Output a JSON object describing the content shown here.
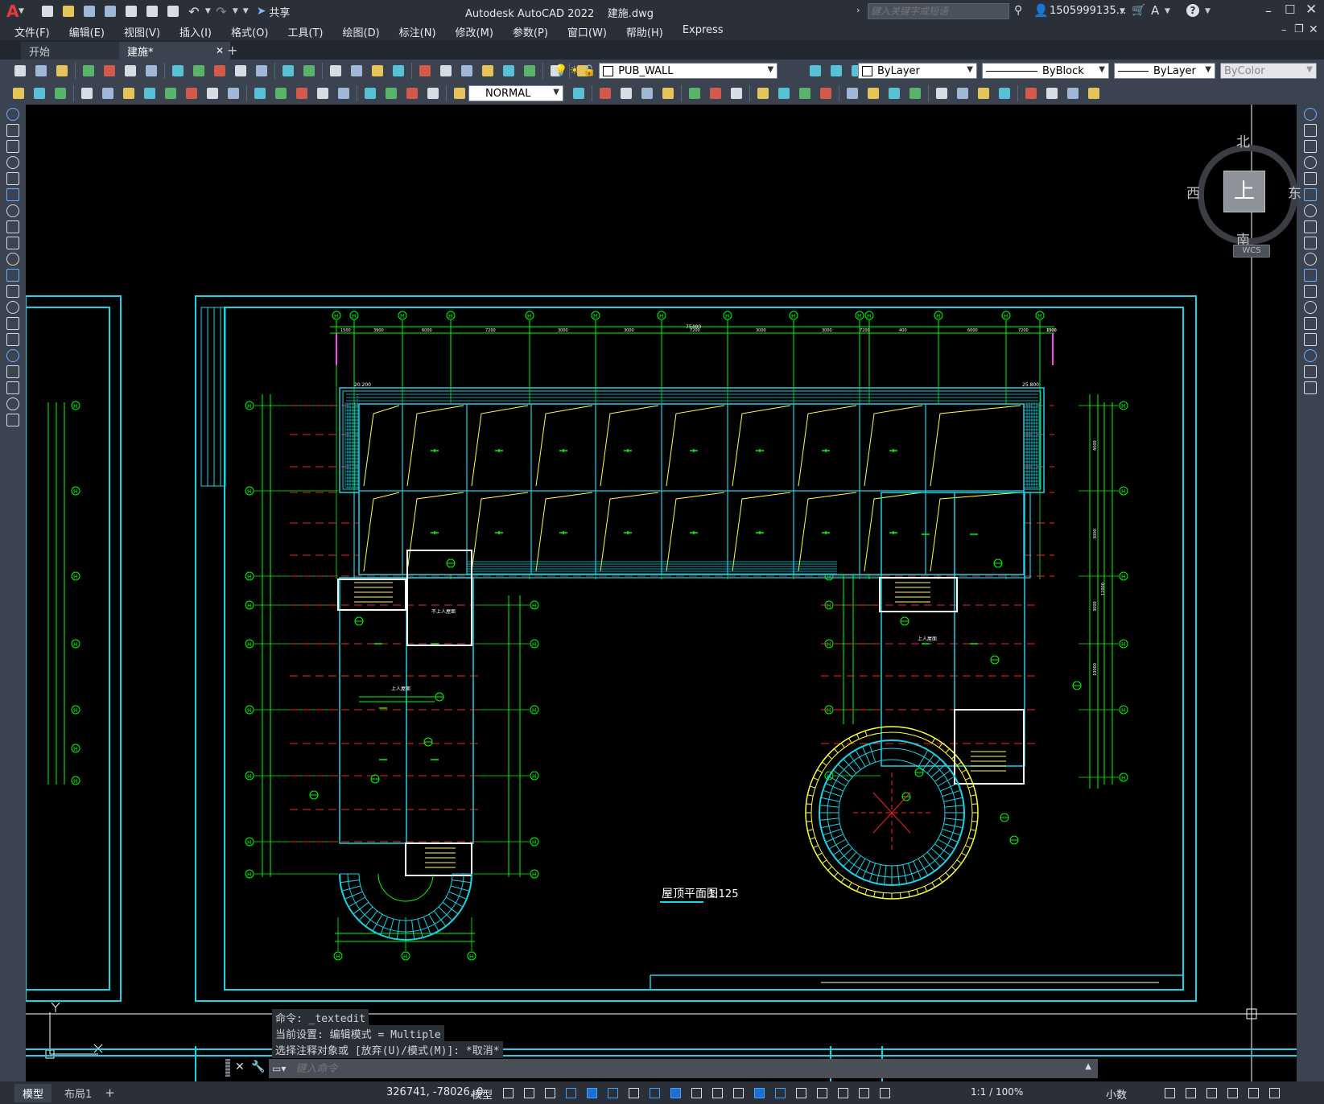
{
  "app": {
    "logo_letter": "A",
    "title": "Autodesk AutoCAD 2022",
    "filename": "建施.dwg",
    "share_label": "共享",
    "search_placeholder": "键入关键字或短语",
    "user": "1505999135...",
    "help": "?"
  },
  "menu": [
    "文件(F)",
    "编辑(E)",
    "视图(V)",
    "插入(I)",
    "格式(O)",
    "工具(T)",
    "绘图(D)",
    "标注(N)",
    "修改(M)",
    "参数(P)",
    "窗口(W)",
    "帮助(H)",
    "Express"
  ],
  "tabs": [
    {
      "label": "开始",
      "active": false
    },
    {
      "label": "建施*",
      "active": true
    }
  ],
  "toolbar": {
    "layer": "PUB_WALL",
    "color": "ByLayer",
    "linetype": "ByBlock",
    "lineweight": "ByLayer",
    "plotstyle": "ByColor",
    "textstyle": "NORMAL"
  },
  "viewcube": {
    "north": "北",
    "south": "南",
    "east": "东",
    "west": "西",
    "top": "上",
    "wcs": "WCS"
  },
  "drawing": {
    "title": "屋顶平面图",
    "scale": "1:125",
    "overall_dim": "75480",
    "dims_top": [
      "1500",
      "3900",
      "6000",
      "7200",
      "3000",
      "3000",
      "7200",
      "3000",
      "3000",
      "7200",
      "400",
      "6000",
      "7200",
      "3300",
      "1500"
    ],
    "grid_bubble": "H",
    "elev_left": "20.200",
    "elev_right": "25.800",
    "right_dims": [
      "4000",
      "3000",
      "3000",
      "10000",
      "12000"
    ],
    "note_a": "上人屋面",
    "note_b": "不上人屋面"
  },
  "command": {
    "history": [
      "命令: _textedit",
      "当前设置: 编辑模式 = Multiple",
      "选择注释对象或 [放弃(U)/模式(M)]: *取消*"
    ],
    "placeholder": "键入命令"
  },
  "status": {
    "model_tab": "模型",
    "layout_tab": "布局1",
    "coords": "326741, -78026, 0",
    "space": "模型",
    "scale": "1:1 / 100%",
    "units": "小数"
  },
  "colors": {
    "cyan": "#19d3e6",
    "green": "#00ff00",
    "red": "#ff2020",
    "yellow": "#ffff40",
    "white": "#ffffff",
    "magenta": "#ff40ff",
    "blue": "#3c7cff"
  }
}
